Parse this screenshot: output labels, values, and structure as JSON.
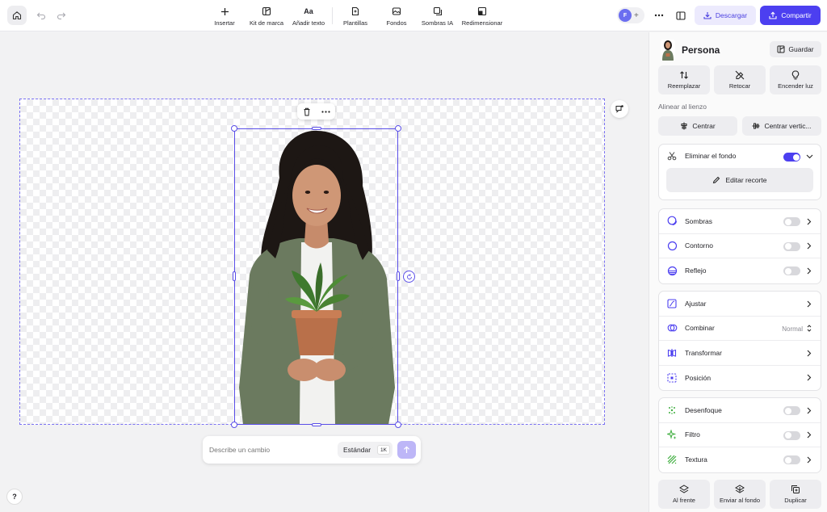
{
  "toolbar": {
    "tools": [
      {
        "label": "Insertar",
        "icon": "plus-icon"
      },
      {
        "label": "Kit de marca",
        "icon": "brand-kit-icon"
      },
      {
        "label": "Añadir texto",
        "icon": "text-icon"
      },
      {
        "label": "Plantillas",
        "icon": "templates-icon"
      },
      {
        "label": "Fondos",
        "icon": "backgrounds-icon"
      },
      {
        "label": "Sombras IA",
        "icon": "ai-shadows-icon"
      },
      {
        "label": "Redimensionar",
        "icon": "resize-icon"
      }
    ],
    "avatar_initial": "F",
    "download_label": "Descargar",
    "share_label": "Compartir"
  },
  "canvas": {
    "prompt_placeholder": "Describe un cambio",
    "quality_label": "Estándar",
    "resolution_badge": "1K",
    "help_label": "?"
  },
  "panel": {
    "title": "Persona",
    "save_label": "Guardar",
    "top_actions": [
      {
        "label": "Reemplazar",
        "icon": "swap-icon"
      },
      {
        "label": "Retocar",
        "icon": "retouch-icon"
      },
      {
        "label": "Encender luz",
        "icon": "lightbulb-icon"
      }
    ],
    "align_label": "Alinear al lienzo",
    "align_buttons": [
      {
        "label": "Centrar",
        "icon": "align-center-icon"
      },
      {
        "label": "Centrar vertic...",
        "icon": "align-vertical-icon"
      }
    ],
    "remove_bg": {
      "label": "Eliminar el fondo",
      "enabled": true,
      "edit_label": "Editar recorte"
    },
    "effects": [
      {
        "label": "Sombras",
        "enabled": false
      },
      {
        "label": "Contorno",
        "enabled": false
      },
      {
        "label": "Reflejo",
        "enabled": false
      }
    ],
    "adjust": [
      {
        "label": "Ajustar"
      },
      {
        "label": "Combinar",
        "value": "Normal"
      },
      {
        "label": "Transformar"
      },
      {
        "label": "Posición"
      }
    ],
    "filters": [
      {
        "label": "Desenfoque",
        "enabled": false
      },
      {
        "label": "Filtro",
        "enabled": false
      },
      {
        "label": "Textura",
        "enabled": false
      }
    ],
    "bottom_actions": [
      {
        "label": "Al frente",
        "icon": "bring-front-icon"
      },
      {
        "label": "Enviar al fondo",
        "icon": "send-back-icon"
      },
      {
        "label": "Duplicar",
        "icon": "duplicate-icon"
      }
    ]
  },
  "colors": {
    "accent": "#4c3ff0",
    "selection": "#5a4ee8",
    "accent_light": "#eceafd"
  }
}
